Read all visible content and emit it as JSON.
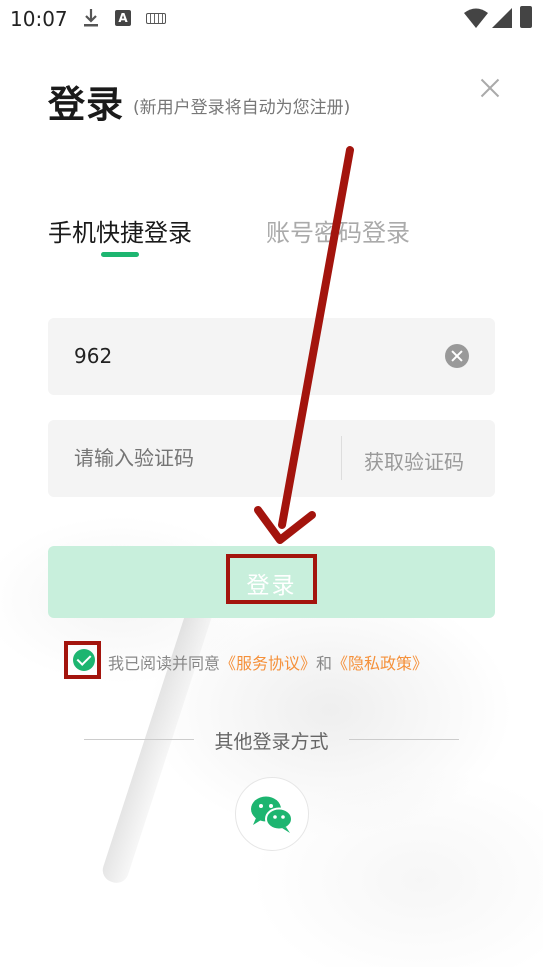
{
  "status_bar": {
    "time": "10:07",
    "a_icon_letter": "A"
  },
  "header": {
    "title": "登录",
    "subtitle": "(新用户登录将自动为您注册)"
  },
  "tabs": [
    {
      "label": "手机快捷登录",
      "active": true
    },
    {
      "label": "账号密码登录",
      "active": false
    }
  ],
  "phone_field": {
    "value": "962"
  },
  "code_field": {
    "placeholder": "请输入验证码",
    "get_code_label": "获取验证码"
  },
  "login_button": {
    "label": "登录"
  },
  "agreement": {
    "checked": true,
    "prefix": "我已阅读并同意",
    "service_link": "《服务协议》",
    "conjunction": "和",
    "privacy_link": "《隐私政策》"
  },
  "other_login": {
    "label": "其他登录方式"
  },
  "colors": {
    "accent": "#1db570",
    "link": "#f5913b",
    "annotation": "#a3140d"
  }
}
